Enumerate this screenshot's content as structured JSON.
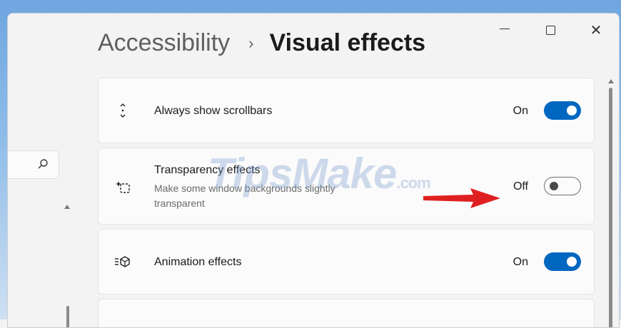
{
  "window": {
    "caption": {
      "minimize_icon": "minimize-icon",
      "maximize_icon": "maximize-icon",
      "close_glyph": "✕"
    }
  },
  "breadcrumb": {
    "parent": "Accessibility",
    "separator": "›",
    "current": "Visual effects"
  },
  "settings": [
    {
      "title": "Always show scrollbars",
      "icon": "scrollbar-arrows-icon",
      "state_label": "On",
      "enabled": true
    },
    {
      "title": "Transparency effects",
      "description": "Make some window backgrounds slightly transparent",
      "icon": "transparency-icon",
      "state_label": "Off",
      "enabled": false
    },
    {
      "title": "Animation effects",
      "icon": "animation-icon",
      "state_label": "On",
      "enabled": true
    }
  ],
  "watermark": {
    "text": "TipsMake",
    "suffix": ".com"
  },
  "colors": {
    "accent": "#0067c0",
    "arrow": "#e02020",
    "background": "#f3f3f3",
    "card": "#fbfbfb"
  }
}
